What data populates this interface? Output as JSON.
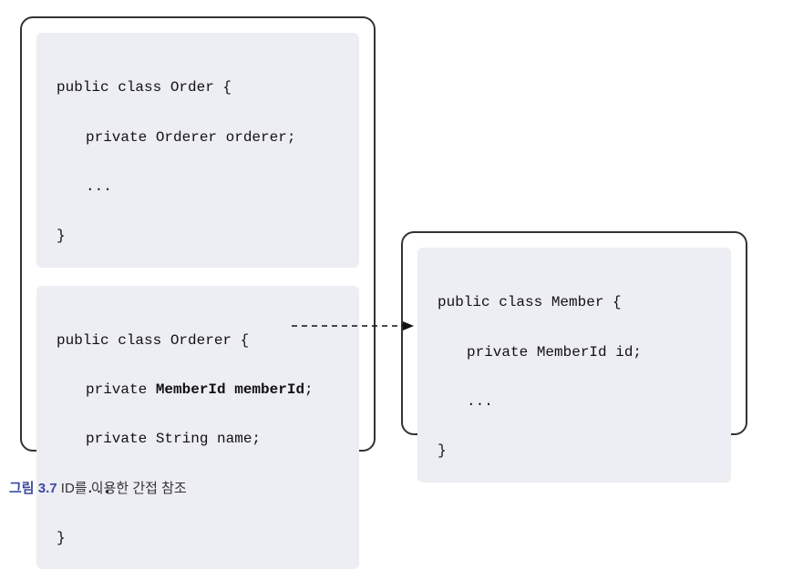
{
  "left": {
    "order": {
      "decl": "public class Order {",
      "field1": "private Orderer orderer;",
      "ellipsis": "...",
      "close": "}"
    },
    "orderer": {
      "decl": "public class Orderer {",
      "field1_prefix": "private ",
      "field1_bold": "MemberId memberId",
      "field1_suffix": ";",
      "field2": "private String name;",
      "ellipsis": "...",
      "close": "}"
    }
  },
  "right": {
    "member": {
      "decl": "public class Member {",
      "field1": "private MemberId id;",
      "ellipsis": "...",
      "close": "}"
    }
  },
  "caption": {
    "label": "그림 3.7",
    "text": " ID를 이용한 간접 참조"
  }
}
